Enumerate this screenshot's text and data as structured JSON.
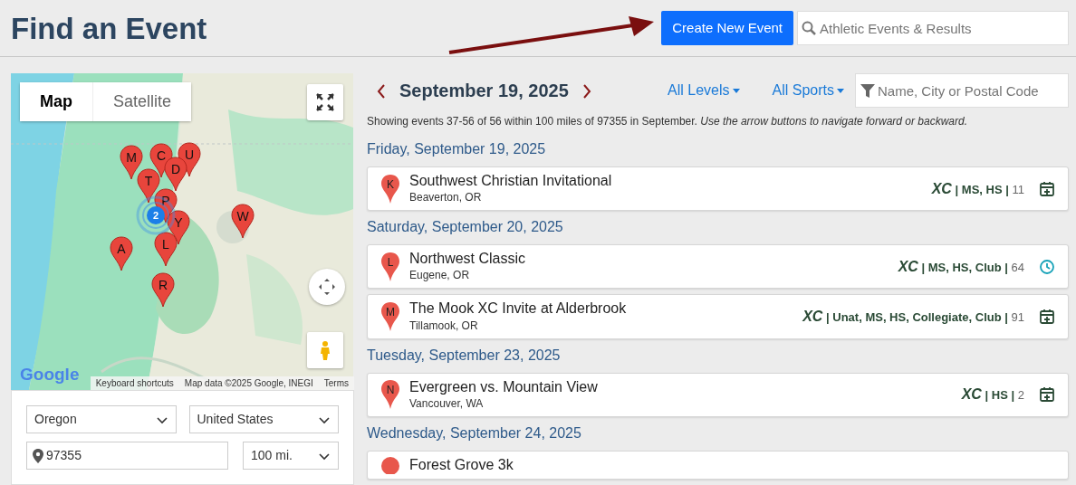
{
  "page": {
    "title": "Find an Event"
  },
  "header": {
    "create_button": "Create New Event",
    "search": {
      "placeholder": "Athletic Events & Results"
    }
  },
  "map": {
    "tabs": [
      {
        "label": "Map",
        "selected": true
      },
      {
        "label": "Satellite",
        "selected": false
      }
    ],
    "markers": [
      {
        "label": "M"
      },
      {
        "label": "C"
      },
      {
        "label": "U"
      },
      {
        "label": "D"
      },
      {
        "label": "T"
      },
      {
        "label": "P"
      },
      {
        "label": "Y"
      },
      {
        "label": "W"
      },
      {
        "label": "A"
      },
      {
        "label": "L"
      },
      {
        "label": "R"
      }
    ],
    "cluster": {
      "count": "2"
    },
    "logo": "Google",
    "attribution": [
      "Keyboard shortcuts",
      "Map data ©2025 Google, INEGI",
      "Terms"
    ]
  },
  "location_form": {
    "state": "Oregon",
    "country": "United States",
    "postal_code": "97355",
    "radius": "100 mi."
  },
  "date_nav": {
    "date": "September 19, 2025"
  },
  "filters": {
    "levels": "All Levels",
    "sports": "All Sports",
    "search": {
      "placeholder": "Name, City or Postal Code"
    }
  },
  "summary": "Showing events 37-56 of 56 within 100 miles of 97355 in September. *Use the arrow buttons to navigate forward or backward.*",
  "days": [
    {
      "date": "Friday, September 19, 2025",
      "events": [
        {
          "marker": "K",
          "name": "Southwest Christian Invitational",
          "location": "Beaverton, OR",
          "sport": "XC",
          "levels": "MS, HS",
          "count": "11",
          "separators": [
            "|",
            "|"
          ],
          "kind": "calendar"
        }
      ]
    },
    {
      "date": "Saturday, September 20, 2025",
      "events": [
        {
          "marker": "L",
          "name": "Northwest Classic",
          "location": "Eugene, OR",
          "sport": "XC",
          "levels": "MS, HS, Club",
          "count": "64",
          "separators": [
            "|",
            "|"
          ],
          "kind": "clock"
        },
        {
          "marker": "M",
          "name": "The Mook XC Invite at Alderbrook",
          "location": "Tillamook, OR",
          "sport": "XC",
          "levels": "Unat, MS, HS, Collegiate, Club",
          "count": "91",
          "separators": [
            "|",
            "|"
          ],
          "kind": "calendar"
        }
      ]
    },
    {
      "date": "Tuesday, September 23, 2025",
      "events": [
        {
          "marker": "N",
          "name": "Evergreen vs. Mountain View",
          "location": "Vancouver, WA",
          "sport": "XC",
          "levels": "HS",
          "count": "2",
          "separators": [
            "|",
            "|"
          ],
          "kind": "calendar"
        }
      ]
    },
    {
      "date": "Wednesday, September 24, 2025",
      "events": [
        {
          "name": "Forest Grove 3k",
          "kind": "partial"
        }
      ]
    }
  ]
}
